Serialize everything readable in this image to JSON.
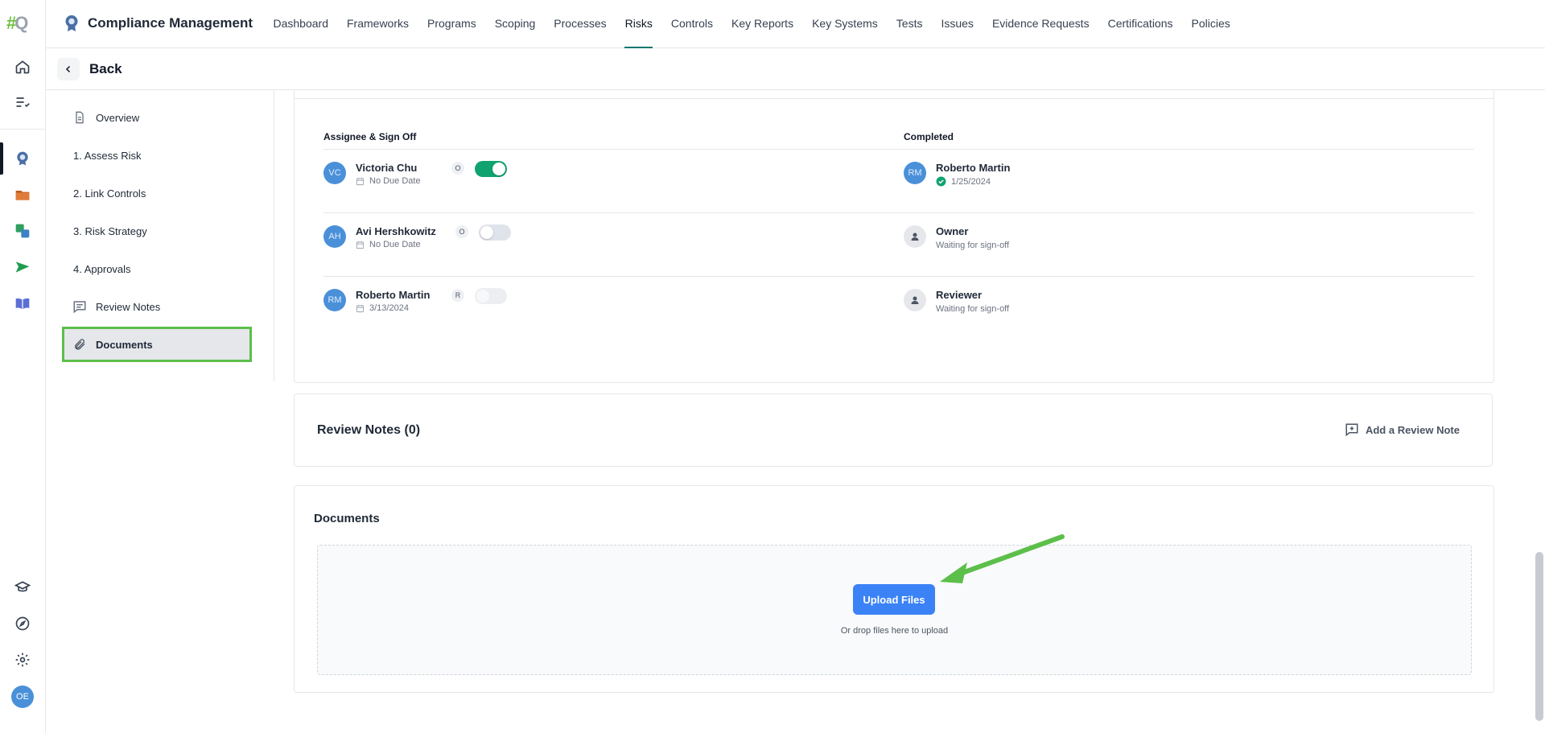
{
  "app": {
    "title": "Compliance Management",
    "rail_user_initials": "OE",
    "logo_hash": "#",
    "logo_q": "Q"
  },
  "nav": {
    "items": [
      "Dashboard",
      "Frameworks",
      "Programs",
      "Scoping",
      "Processes",
      "Risks",
      "Controls",
      "Key Reports",
      "Key Systems",
      "Tests",
      "Issues",
      "Evidence Requests",
      "Certifications",
      "Policies"
    ],
    "active": "Risks"
  },
  "back": {
    "label": "Back"
  },
  "side_menu": {
    "overview": "Overview",
    "assess_risk": "1. Assess Risk",
    "link_controls": "2. Link Controls",
    "risk_strategy": "3. Risk Strategy",
    "approvals": "4. Approvals",
    "review_notes": "Review Notes",
    "documents": "Documents"
  },
  "assignees": {
    "col_assignee": "Assignee & Sign Off",
    "col_completed": "Completed",
    "rows": [
      {
        "initials": "VC",
        "name": "Victoria Chu",
        "role": "O",
        "due": "No Due Date",
        "toggle": "on",
        "completed_initials": "RM",
        "completed_name": "Roberto Martin",
        "completed_sub": "1/25/2024"
      },
      {
        "initials": "AH",
        "name": "Avi Hershkowitz",
        "role": "O",
        "due": "No Due Date",
        "toggle": "off",
        "completed_name": "Owner",
        "completed_sub": "Waiting for sign-off"
      },
      {
        "initials": "RM",
        "name": "Roberto Martin",
        "role": "R",
        "due": "3/13/2024",
        "toggle": "disabled",
        "completed_name": "Reviewer",
        "completed_sub": "Waiting for sign-off"
      }
    ]
  },
  "review_notes": {
    "title": "Review Notes (0)",
    "add_label": "Add a Review Note"
  },
  "documents": {
    "title": "Documents",
    "upload_label": "Upload Files",
    "drop_hint": "Or drop files here to upload"
  },
  "colors": {
    "accent": "#3b82f6",
    "toggle_on": "#10a36f",
    "highlight": "#5cbf4a",
    "avatar": "#4a90d9"
  }
}
